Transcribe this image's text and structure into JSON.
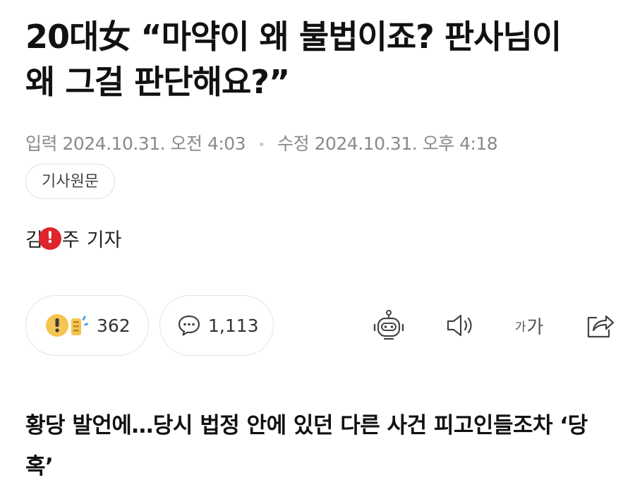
{
  "article": {
    "headline": "20대女 “마약이 왜 불법이죠? 판사님이 왜 그걸 판단해요?”",
    "meta": {
      "input_label": "입력",
      "input_time": "2024.10.31. 오전 4:03",
      "edit_label": "수정",
      "edit_time": "2024.10.31. 오후 4:18"
    },
    "original_button": "기사원문",
    "reporter": {
      "name_start": "김",
      "name_end": "주",
      "title": "기자"
    },
    "actions": {
      "reaction_count": "362",
      "comment_count": "1,113",
      "font_small": "가",
      "font_large": "가"
    },
    "subheadline": "황당 발언에…당시 법정 안에 있던 다른 사건 피고인들조차 ‘당혹’"
  },
  "icons": {
    "reaction": "reaction-emoji-icon",
    "comment": "speech-bubble-icon",
    "summary_bot": "robot-icon",
    "read_aloud": "speaker-icon",
    "font_size": "font-size-icon",
    "share": "share-icon",
    "warning": "warning-badge-icon"
  },
  "colors": {
    "warning": "#e0242b",
    "reaction_yellow": "#f5c451",
    "reaction_blue": "#4da3e6"
  }
}
